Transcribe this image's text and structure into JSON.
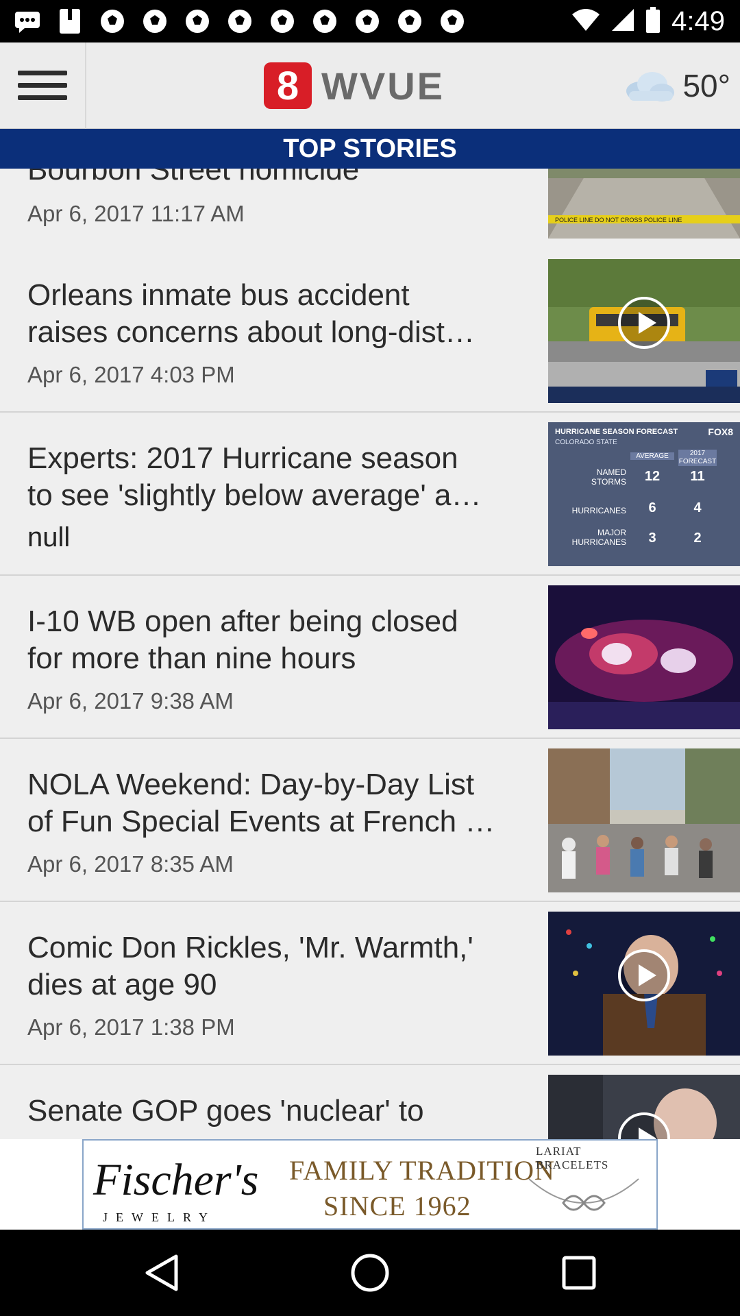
{
  "status_bar": {
    "time": "4:49"
  },
  "header": {
    "logo_number": "8",
    "logo_text": "WVUE",
    "weather_temp": "50°"
  },
  "section": {
    "title": "TOP STORIES"
  },
  "stories": [
    {
      "headline": "Bourbon Street homicide",
      "date": "Apr 6, 2017 11:17 AM"
    },
    {
      "headline_1": "Orleans inmate bus accident",
      "headline_2": "raises concerns about long-dist…",
      "date": "Apr 6, 2017 4:03 PM",
      "has_video": true
    },
    {
      "headline_1": "Experts: 2017 Hurricane season",
      "headline_2": "to see 'slightly below average' a…",
      "extra": "null"
    },
    {
      "headline_1": "I-10 WB open after being closed",
      "headline_2": "for more than nine hours",
      "date": "Apr 6, 2017 9:38 AM"
    },
    {
      "headline_1": "NOLA Weekend: Day-by-Day List",
      "headline_2": "of Fun Special Events at French …",
      "date": "Apr 6, 2017 8:35 AM"
    },
    {
      "headline_1": "Comic Don Rickles, 'Mr. Warmth,'",
      "headline_2": "dies at age 90",
      "date": "Apr 6, 2017 1:38 PM",
      "has_video": true
    },
    {
      "headline_1": "Senate GOP goes 'nuclear' to",
      "has_video": true
    }
  ],
  "hurricane_graphic": {
    "title": "HURRICANE SEASON FORECAST",
    "subtitle": "COLORADO STATE",
    "brand": "FOX8",
    "col_avg": "AVERAGE",
    "col_forecast": "2017 FORECAST",
    "rows": [
      {
        "label_1": "NAMED",
        "label_2": "STORMS",
        "avg": "12",
        "forecast": "11"
      },
      {
        "label_1": "HURRICANES",
        "label_2": "",
        "avg": "6",
        "forecast": "4"
      },
      {
        "label_1": "MAJOR",
        "label_2": "HURRICANES",
        "avg": "3",
        "forecast": "2"
      }
    ]
  },
  "ad": {
    "brand": "Fischer's",
    "brand_sub": "JEWELRY",
    "tagline_1": "FAMILY TRADITION",
    "tagline_2": "SINCE 1962",
    "product": "LARIAT BRACELETS"
  },
  "colors": {
    "section_bar": "#0b2f7a",
    "logo_red": "#d81e27",
    "list_bg": "#efefef"
  }
}
